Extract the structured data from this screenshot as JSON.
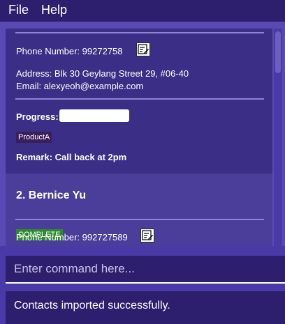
{
  "menu": {
    "items": [
      "File",
      "Help"
    ]
  },
  "contacts": [
    {
      "phone_label": "Phone Number: 99272758",
      "address_label": "Address: Blk 30 Geylang Street 29, #06-40",
      "email_label": "Email: alexyeoh@example.com",
      "progress_label": "Progress:",
      "progress_value": 1.0,
      "tag": "ProductA",
      "remark_label": "Remark: Call back at 2pm"
    },
    {
      "name_label": "2.  Bernice Yu",
      "status": "COMPLETE",
      "phone_label": "Phone Number: 992727589"
    }
  ],
  "command": {
    "placeholder": "Enter command here...",
    "value": ""
  },
  "result": {
    "message": "Contacts imported successfully."
  },
  "colors": {
    "menubar": "#2e1f6e",
    "panel": "#3b2e86",
    "selected_card": "#4b3e9a",
    "complete_tag": "#2e8b2e",
    "product_tag": "#3a1f5c"
  },
  "icons": {
    "edit": "edit-icon"
  }
}
